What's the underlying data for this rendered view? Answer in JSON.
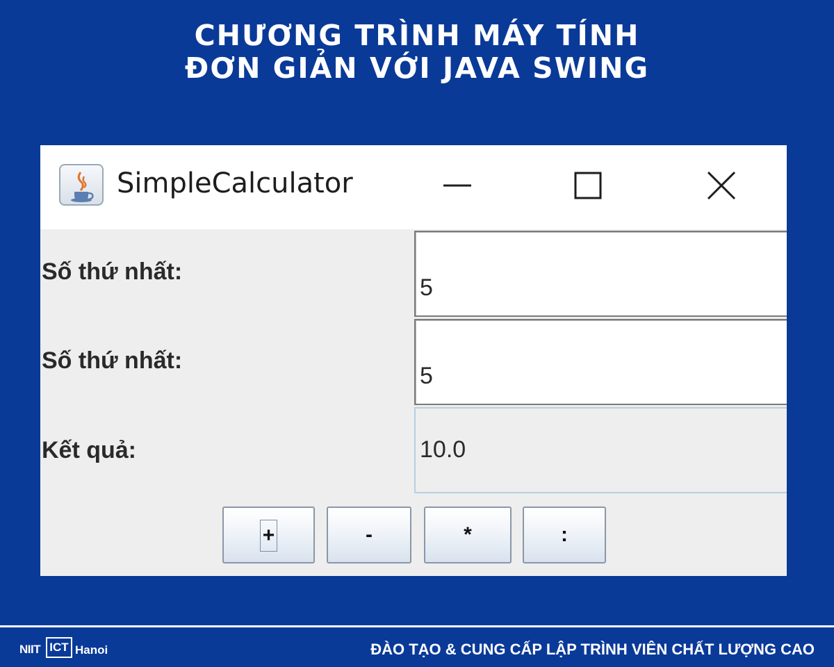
{
  "headline": {
    "line1": "CHƯƠNG TRÌNH MÁY TÍNH",
    "line2": "ĐƠN GIẢN VỚI JAVA SWING"
  },
  "window": {
    "title": "SimpleCalculator",
    "icon": "java-icon",
    "controls": {
      "minimize": "minimize-icon",
      "maximize": "maximize-icon",
      "close": "close-icon"
    }
  },
  "form": {
    "first_label": "Số thứ nhất:",
    "first_value": "5",
    "second_label": "Số thứ nhất:",
    "second_value": "5",
    "result_label": "Kết quả:",
    "result_value": "10.0"
  },
  "buttons": {
    "add": "+",
    "subtract": "-",
    "multiply": "*",
    "divide": ":"
  },
  "footer": {
    "logo_niit": "NIIT",
    "logo_kt": "ICT",
    "logo_city": "Hanoi",
    "tagline": "ĐÀO TẠO & CUNG CẤP LẬP TRÌNH VIÊN CHẤT LƯỢNG CAO"
  },
  "colors": {
    "background": "#0a3a98",
    "window_body": "#eeeeee",
    "titlebar": "#ffffff",
    "result_border": "#b8cfe0"
  }
}
